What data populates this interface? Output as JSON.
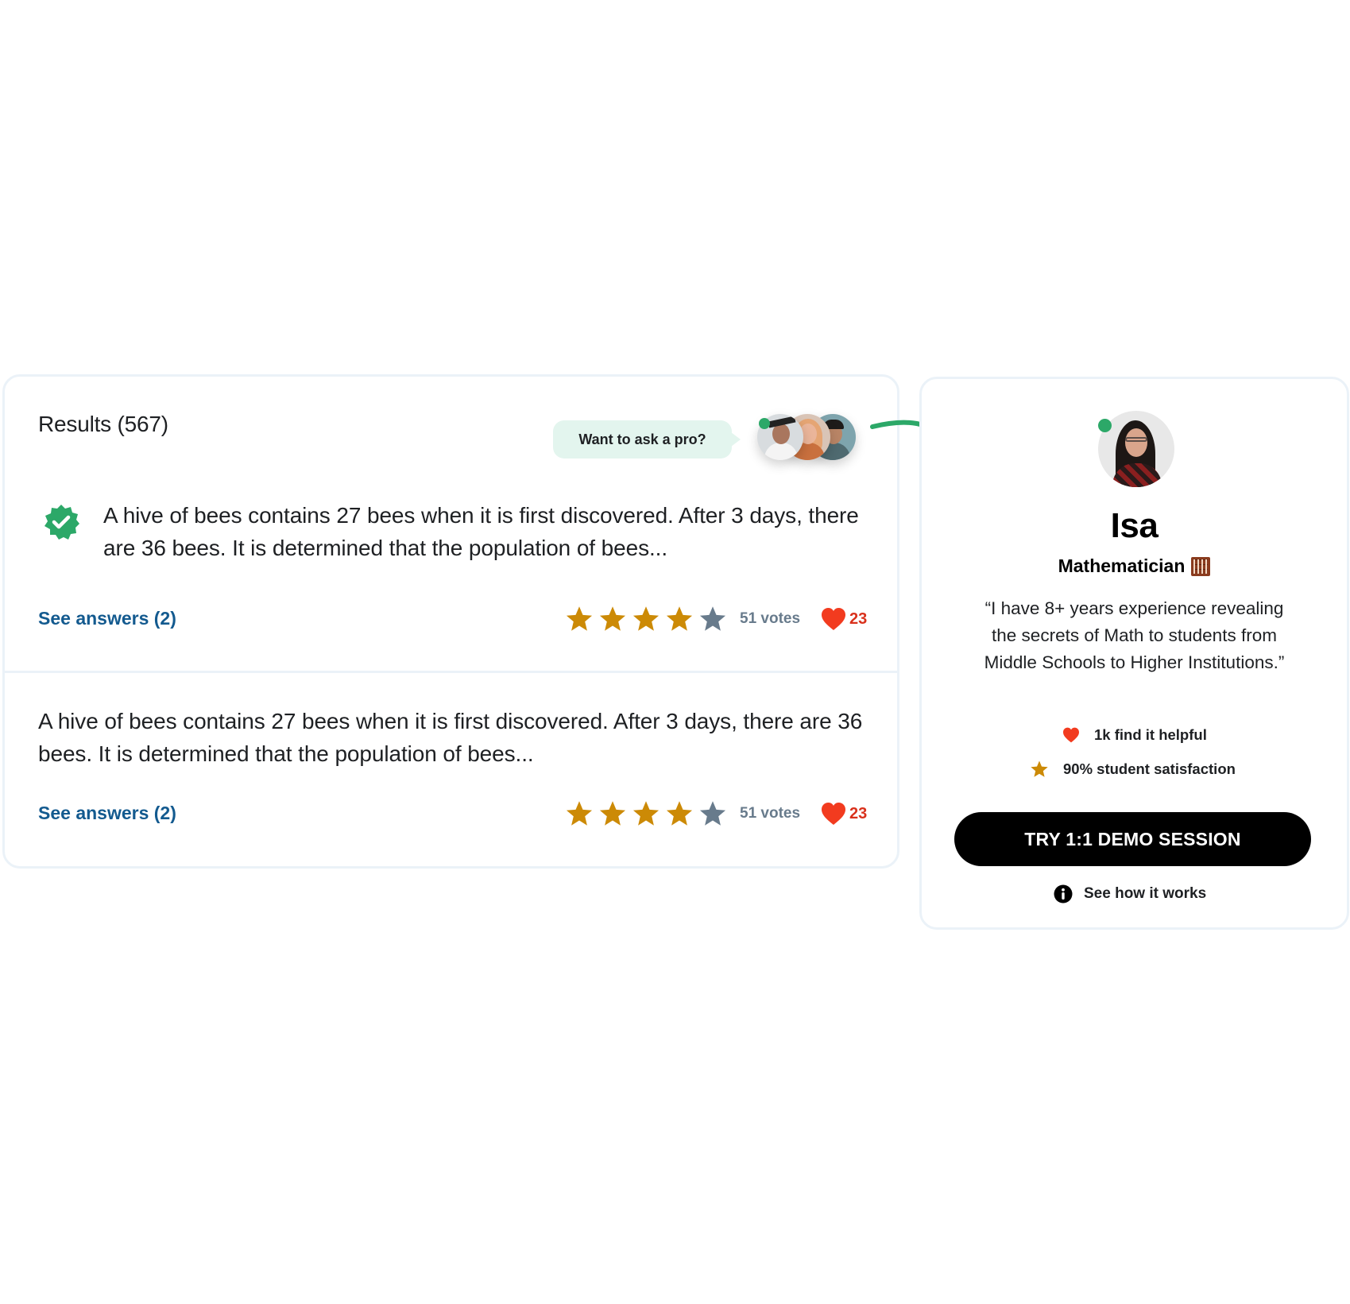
{
  "results": {
    "title": "Results (567)",
    "ask_pro_label": "Want to ask a pro?",
    "tutor_avatars": [
      "tutor-avatar-graduate",
      "tutor-avatar-redhead",
      "tutor-avatar-man"
    ],
    "items": [
      {
        "verified": true,
        "question": "A hive of bees contains 27 bees when it is first discovered. After 3 days, there are 36 bees. It is determined that the population of bees...",
        "see_answers_label": "See answers (2)",
        "rating": 4,
        "rating_max": 5,
        "votes_label": "51 votes",
        "likes": "23"
      },
      {
        "verified": false,
        "question": "A hive of bees contains 27 bees when it is first discovered. After 3 days, there are 36 bees. It is determined that the population of bees...",
        "see_answers_label": "See answers (2)",
        "rating": 4,
        "rating_max": 5,
        "votes_label": "51 votes",
        "likes": "23"
      }
    ]
  },
  "tutor": {
    "name": "Isa",
    "title": "Mathematician",
    "title_icon": "abacus-icon",
    "online": true,
    "quote": "“I have 8+ years experience revealing the secrets of Math to students from Middle Schools to Higher Institutions.”",
    "stats": {
      "helpful_label": "1k find it helpful",
      "satisfaction_label": "90% student satisfaction"
    },
    "cta_label": "TRY 1:1 DEMO SESSION",
    "how_it_works_label": "See how it works"
  },
  "colors": {
    "accent_green": "#2ca868",
    "link_blue": "#135a8f",
    "star_gold": "#cc8a06",
    "star_empty": "#687b8c",
    "heart_red": "#f23b1f",
    "pill_bg": "#e3f5ee",
    "border": "#ebf2f8"
  }
}
